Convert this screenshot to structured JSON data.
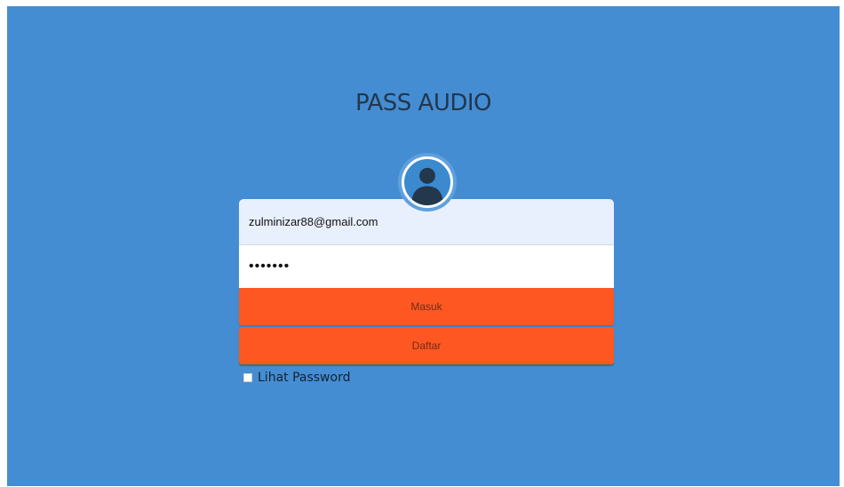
{
  "app": {
    "title": "PASS AUDIO"
  },
  "login_form": {
    "email_value": "zulminizar88@gmail.com",
    "password_value": "•••••••",
    "login_button_label": "Masuk",
    "register_button_label": "Daftar",
    "show_password_label": "Lihat Password",
    "show_password_checked": false
  },
  "icons": {
    "avatar": "user-avatar-icon"
  },
  "colors": {
    "background": "#448dd3",
    "button": "#ff5722",
    "title": "#23374d"
  }
}
